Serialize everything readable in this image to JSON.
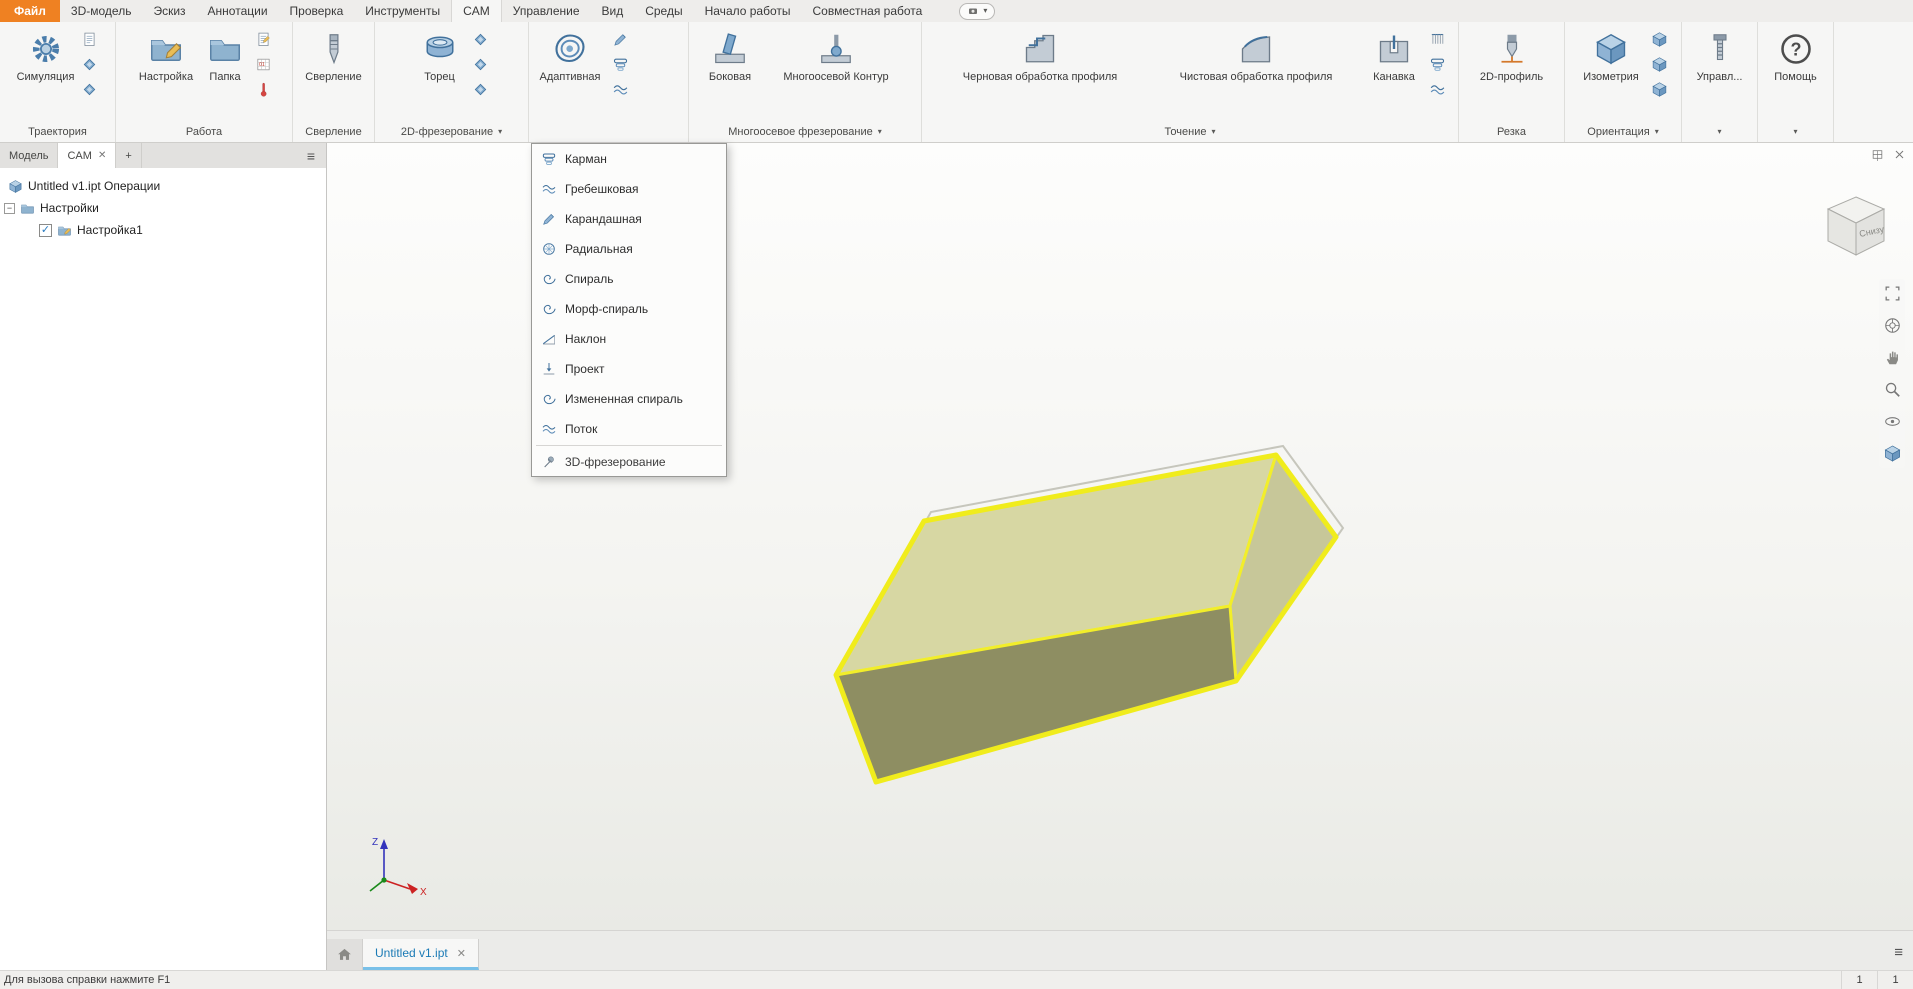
{
  "ui": {
    "caret": "▾",
    "close": "✕",
    "hamburger": "≡",
    "plus": "+",
    "minus": "−",
    "check": "✓"
  },
  "menu": {
    "file": "Файл",
    "items": [
      "3D-модель",
      "Эскиз",
      "Аннотации",
      "Проверка",
      "Инструменты",
      "CAM",
      "Управление",
      "Вид",
      "Среды",
      "Начало работы",
      "Совместная работа"
    ],
    "active": "CAM"
  },
  "ribbon": {
    "trajectory": {
      "label": "Траектория",
      "simulate": "Симуляция"
    },
    "job": {
      "label": "Работа",
      "setup": "Настройка",
      "folder": "Папка"
    },
    "drilling": {
      "label": "Сверление",
      "drill": "Сверление"
    },
    "milling2d": {
      "label": "2D-фрезерование",
      "face": "Торец"
    },
    "milling3d": {
      "adaptive": "Адаптивная"
    },
    "multiaxis": {
      "label": "Многоосевое фрезерование",
      "swarf": "Боковая",
      "contour": "Многоосевой Контур"
    },
    "turning": {
      "label": "Точение",
      "rough": "Черновая обработка профиля",
      "finish": "Чистовая обработка профиля",
      "groove": "Канавка"
    },
    "cutting": {
      "label": "Резка",
      "profile2d": "2D-профиль"
    },
    "orientation": {
      "label": "Ориентация",
      "iso": "Изометрия"
    },
    "manage": {
      "label": "Управл..."
    },
    "help": {
      "label": "Помощь"
    }
  },
  "adaptive_menu": {
    "items": [
      {
        "label": "Карман"
      },
      {
        "label": "Гребешковая"
      },
      {
        "label": "Карандашная"
      },
      {
        "label": "Радиальная"
      },
      {
        "label": "Спираль"
      },
      {
        "label": "Морф-спираль"
      },
      {
        "label": "Наклон"
      },
      {
        "label": "Проект"
      },
      {
        "label": "Измененная спираль"
      },
      {
        "label": "Поток"
      }
    ],
    "footer": "3D-фрезерование"
  },
  "browser": {
    "tabs": {
      "model": "Модель",
      "cam": "CAM",
      "add": "+"
    },
    "tree": {
      "root": "Untitled v1.ipt Операции",
      "settings": "Настройки",
      "setup1": "Настройка1"
    }
  },
  "viewport": {
    "viewcube_label": "Снизу",
    "axes": {
      "x": "X",
      "z": "Z"
    }
  },
  "doc_tabs": {
    "active": "Untitled v1.ipt"
  },
  "statusbar": {
    "help": "Для вызова справки нажмите F1",
    "left_num": "1",
    "right_num": "1"
  },
  "colors": {
    "accent_orange": "#ef8122",
    "highlight_yellow": "#f0ec1c",
    "face_top": "#d7d7a3",
    "face_front": "#8e8e62",
    "face_right": "#c7c799",
    "tab_blue": "#1a7ab5"
  }
}
